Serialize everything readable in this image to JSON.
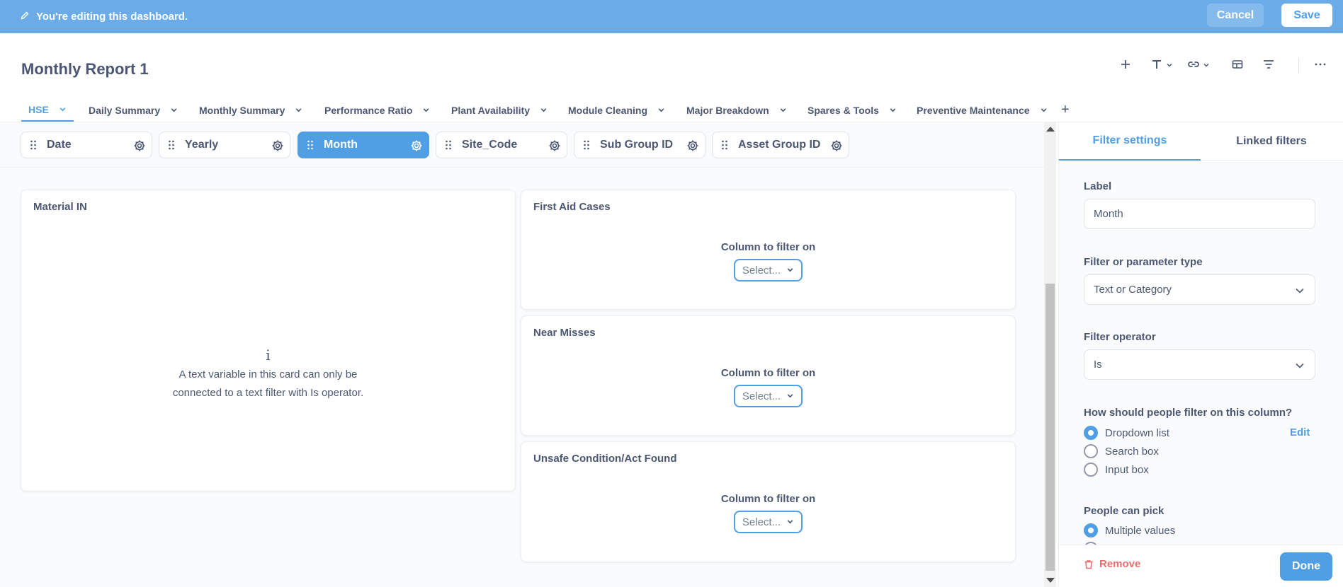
{
  "edit_bar": {
    "message": "You're editing this dashboard.",
    "cancel_label": "Cancel",
    "save_label": "Save",
    "color": "#6aabe8"
  },
  "dashboard": {
    "title": "Monthly Report 1"
  },
  "toolbar_icons": [
    "add-icon",
    "text-icon",
    "link-icon",
    "section-icon",
    "filter-icon",
    "more-icon"
  ],
  "tabs": [
    {
      "label": "HSE",
      "active": true
    },
    {
      "label": "Daily Summary"
    },
    {
      "label": "Monthly Summary"
    },
    {
      "label": "Performance Ratio"
    },
    {
      "label": "Plant Availability"
    },
    {
      "label": "Module Cleaning"
    },
    {
      "label": "Major Breakdown"
    },
    {
      "label": "Spares & Tools"
    },
    {
      "label": "Preventive Maintenance"
    }
  ],
  "tab_add": "+",
  "filters": [
    {
      "label": "Date"
    },
    {
      "label": "Yearly"
    },
    {
      "label": "Month",
      "active": true
    },
    {
      "label": "Site_Code"
    },
    {
      "label": "Sub Group ID"
    },
    {
      "label": "Asset Group ID"
    }
  ],
  "cards": {
    "material_in": {
      "title": "Material IN",
      "info_glyph": "i",
      "info_text": "A text variable in this card can only be connected to a text filter with Is operator."
    },
    "first_aid": {
      "title": "First Aid Cases",
      "column_label": "Column to filter on",
      "select_label": "Select..."
    },
    "near_misses": {
      "title": "Near Misses",
      "column_label": "Column to filter on",
      "select_label": "Select..."
    },
    "unsafe": {
      "title": "Unsafe Condition/Act Found",
      "column_label": "Column to filter on",
      "select_label": "Select..."
    }
  },
  "sidebar": {
    "tab_settings": "Filter settings",
    "tab_linked": "Linked filters",
    "label_title": "Label",
    "label_value": "Month",
    "type_title": "Filter or parameter type",
    "type_value": "Text or Category",
    "operator_title": "Filter operator",
    "operator_value": "Is",
    "how_title": "How should people filter on this column?",
    "how_options": [
      {
        "label": "Dropdown list",
        "checked": true
      },
      {
        "label": "Search box",
        "checked": false
      },
      {
        "label": "Input box",
        "checked": false
      }
    ],
    "edit_label": "Edit",
    "pick_title": "People can pick",
    "pick_options": [
      {
        "label": "Multiple values",
        "checked": true
      }
    ],
    "remove_label": "Remove",
    "done_label": "Done"
  },
  "colors": {
    "brand": "#509ee3",
    "danger": "#ed6e6e",
    "text": "#4c5773"
  }
}
